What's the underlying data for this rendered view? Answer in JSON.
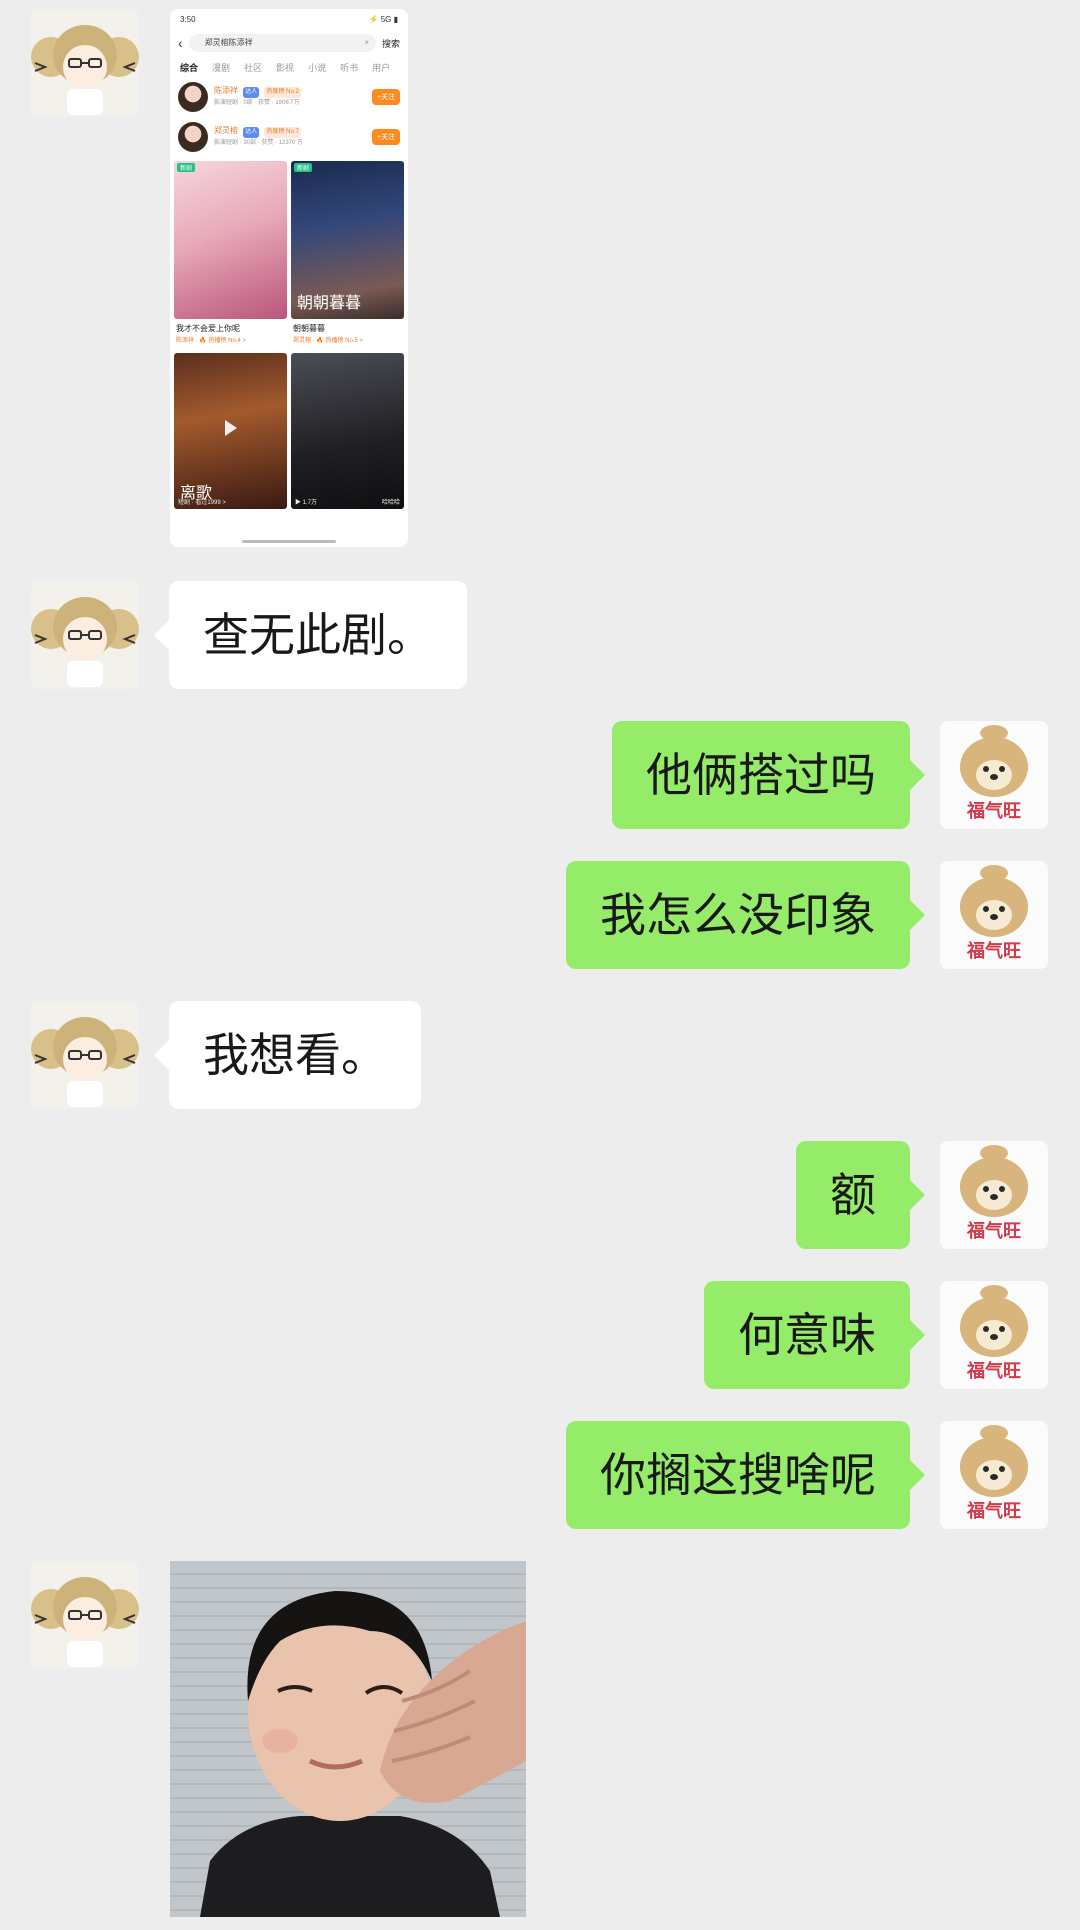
{
  "chat": {
    "image_message": {
      "status_time": "3:50",
      "status_icons": "⚡ 5G ▮",
      "search_query": "郑灵榕陈添祥",
      "search_clear": "×",
      "search_button": "搜索",
      "tabs": [
        "综合",
        "漫剧",
        "社区",
        "影视",
        "小说",
        "听书",
        "用户"
      ],
      "people": [
        {
          "name": "陈添祥",
          "tag": "达人",
          "tag2": "热度榜 No.2",
          "sub": "影演短剧 · 0部 · 获赞 · 1906.7万",
          "follow": "+关注"
        },
        {
          "name": "郑灵榕",
          "tag": "达人",
          "tag2": "热度榜 No.7",
          "sub": "影演短剧 · 30部 · 获赞 · 12370 万",
          "follow": "+关注"
        }
      ],
      "cards": [
        {
          "badge": "新剧",
          "overlay": "",
          "title": "我才不会爱上你呢",
          "meta": "陈添祥 · 🔥 热播榜 No.4 >"
        },
        {
          "badge": "新剧",
          "overlay": "朝朝暮暮",
          "title": "朝朝暮暮",
          "meta": "郑灵榕 · 🔥 热播榜 No.5 >"
        },
        {
          "badge": "",
          "overlay": "离歌",
          "corner_left": "短剧 · 看过1999 >",
          "corner_right": ""
        },
        {
          "badge": "",
          "overlay": "",
          "corner_left": "▶ 1.7万",
          "corner_right": "哈哈哈"
        }
      ]
    },
    "messages": [
      {
        "side": "in",
        "text": "查无此剧。"
      },
      {
        "side": "out",
        "text": "他俩搭过吗"
      },
      {
        "side": "out",
        "text": "我怎么没印象"
      },
      {
        "side": "in",
        "text": "我想看。"
      },
      {
        "side": "out",
        "text": "额"
      },
      {
        "side": "out",
        "text": "何意味"
      },
      {
        "side": "out",
        "text": "你搁这搜啥呢"
      }
    ],
    "my_avatar_caption": "福气旺",
    "colors": {
      "background": "#ededed",
      "out_bubble": "#95ec69",
      "in_bubble": "#ffffff"
    }
  }
}
